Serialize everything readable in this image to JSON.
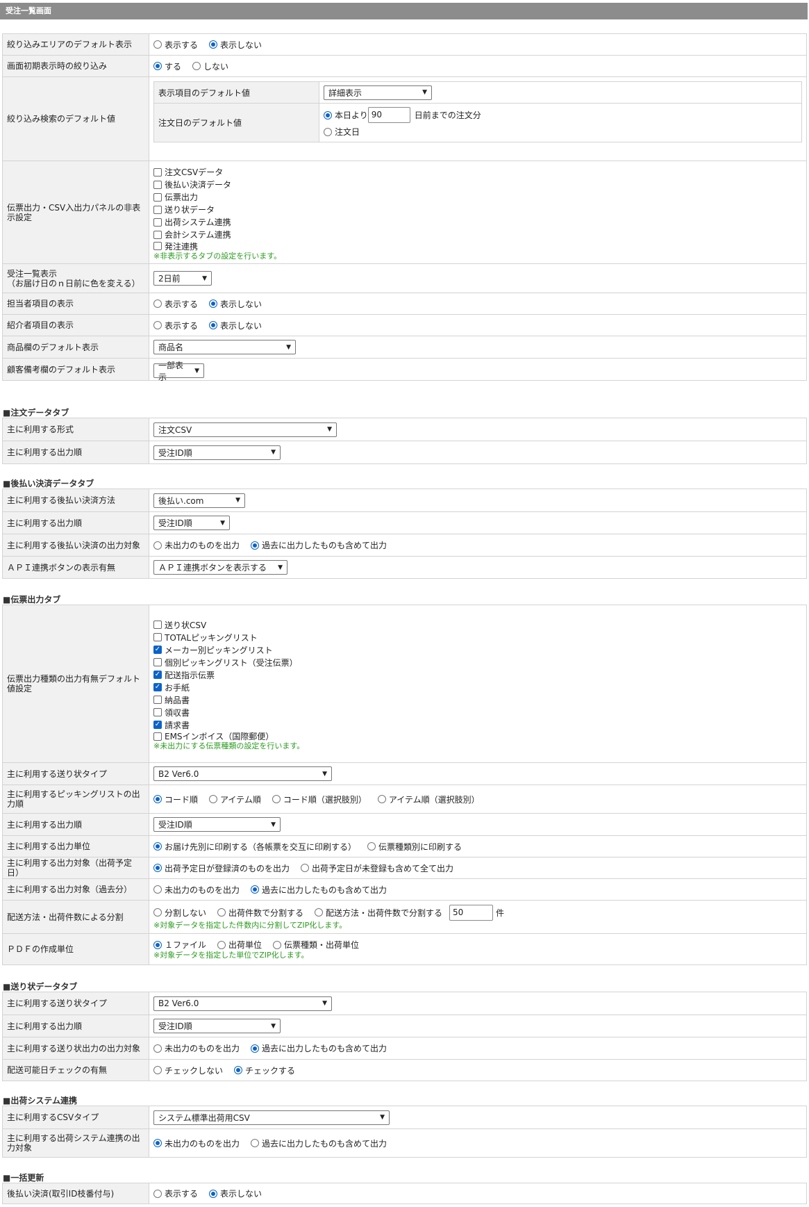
{
  "title": "受注一覧画面",
  "general": {
    "filter_area_label": "絞り込みエリアのデフォルト表示",
    "filter_area_opts": [
      "表示する",
      "表示しない"
    ],
    "initial_filter_label": "画面初期表示時の絞り込み",
    "initial_filter_opts": [
      "する",
      "しない"
    ],
    "search_default_label": "絞り込み検索のデフォルト値",
    "display_items_label": "表示項目のデフォルト値",
    "display_items_value": "詳細表示",
    "order_date_label": "注文日のデフォルト値",
    "order_date_opt1": "本日より",
    "order_date_days": "90",
    "order_date_suffix": "日前までの注文分",
    "order_date_opt2": "注文日",
    "panel_hide_label": "伝票出力・CSV入出力パネルの非表示設定",
    "panel_items": [
      "注文CSVデータ",
      "後払い決済データ",
      "伝票出力",
      "送り状データ",
      "出荷システム連携",
      "会計システム連携",
      "発注連携"
    ],
    "panel_note": "※非表示するタブの設定を行います。",
    "list_display_label": "受注一覧表示",
    "list_display_sub": "（お届け日のｎ日前に色を変える）",
    "list_display_value": "2日前",
    "staff_label": "担当者項目の表示",
    "staff_opts": [
      "表示する",
      "表示しない"
    ],
    "referrer_label": "紹介者項目の表示",
    "referrer_opts": [
      "表示する",
      "表示しない"
    ],
    "product_label": "商品欄のデフォルト表示",
    "product_value": "商品名",
    "customer_label": "顧客備考欄のデフォルト表示",
    "customer_value": "一部表示"
  },
  "order_tab": {
    "title": "■注文データタブ",
    "format_label": "主に利用する形式",
    "format_value": "注文CSV",
    "order_label": "主に利用する出力順",
    "order_value": "受注ID順"
  },
  "deferred_tab": {
    "title": "■後払い決済データタブ",
    "method_label": "主に利用する後払い決済方法",
    "method_value": "後払い.com",
    "order_label": "主に利用する出力順",
    "order_value": "受注ID順",
    "target_label": "主に利用する後払い決済の出力対象",
    "target_opts": [
      "未出力のものを出力",
      "過去に出力したものも含めて出力"
    ],
    "api_label": "ＡＰＩ連携ボタンの表示有無",
    "api_value": "ＡＰＩ連携ボタンを表示する"
  },
  "slip_tab": {
    "title": "■伝票出力タブ",
    "kinds_label": "伝票出力種類の出力有無デフォルト値設定",
    "kinds": [
      "送り状CSV",
      "TOTALピッキングリスト",
      "メーカー別ピッキングリスト",
      "個別ピッキングリスト（受注伝票）",
      "配送指示伝票",
      "お手紙",
      "納品書",
      "領収書",
      "請求書",
      "EMSインボイス（国際郵便）"
    ],
    "kinds_note": "※未出力にする伝票種類の設定を行います。",
    "invoice_type_label": "主に利用する送り状タイプ",
    "invoice_type_value": "B2 Ver6.0",
    "picking_label": "主に利用するピッキングリストの出力順",
    "picking_opts": [
      "コード順",
      "アイテム順",
      "コード順（選択肢別）",
      "アイテム順（選択肢別）"
    ],
    "order_label": "主に利用する出力順",
    "order_value": "受注ID順",
    "unit_label": "主に利用する出力単位",
    "unit_opts": [
      "お届け先別に印刷する（各帳票を交互に印刷する）",
      "伝票種類別に印刷する"
    ],
    "target_ship_label": "主に利用する出力対象（出荷予定日）",
    "target_ship_opts": [
      "出荷予定日が登録済のものを出力",
      "出荷予定日が未登録も含めて全て出力"
    ],
    "target_past_label": "主に利用する出力対象（過去分）",
    "target_past_opts": [
      "未出力のものを出力",
      "過去に出力したものも含めて出力"
    ],
    "split_label": "配送方法・出荷件数による分割",
    "split_opts": [
      "分割しない",
      "出荷件数で分割する",
      "配送方法・出荷件数で分割する"
    ],
    "split_count": "50",
    "split_unit": "件",
    "split_note": "※対象データを指定した件数内に分割してZIP化します。",
    "pdf_label": "ＰＤＦの作成単位",
    "pdf_opts": [
      "１ファイル",
      "出荷単位",
      "伝票種類・出荷単位"
    ],
    "pdf_note": "※対象データを指定した単位でZIP化します。"
  },
  "label_tab": {
    "title": "■送り状データタブ",
    "type_label": "主に利用する送り状タイプ",
    "type_value": "B2 Ver6.0",
    "order_label": "主に利用する出力順",
    "order_value": "受注ID順",
    "target_label": "主に利用する送り状出力の出力対象",
    "target_opts": [
      "未出力のものを出力",
      "過去に出力したものも含めて出力"
    ],
    "check_label": "配送可能日チェックの有無",
    "check_opts": [
      "チェックしない",
      "チェックする"
    ]
  },
  "ship_tab": {
    "title": "■出荷システム連携",
    "csv_label": "主に利用するCSVタイプ",
    "csv_value": "システム標準出荷用CSV",
    "target_label": "主に利用する出荷システム連携の出力対象",
    "target_opts": [
      "未出力のものを出力",
      "過去に出力したものも含めて出力"
    ]
  },
  "bulk_tab": {
    "title": "■一括更新",
    "deferred_label": "後払い決済(取引ID枝番付与)",
    "deferred_opts": [
      "表示する",
      "表示しない"
    ]
  }
}
